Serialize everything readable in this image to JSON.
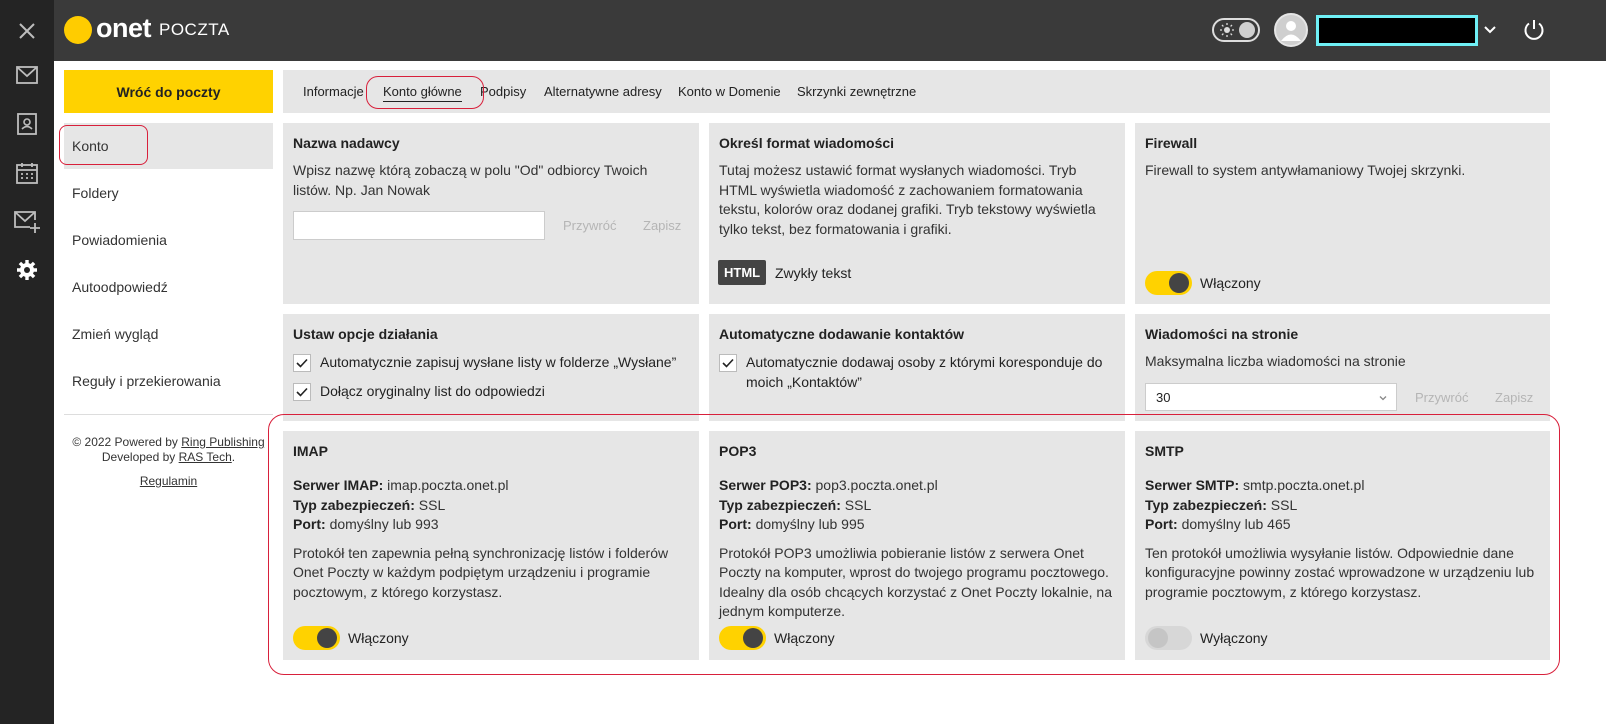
{
  "header": {
    "logo_text": "onet",
    "logo_product": "POCZTA"
  },
  "nav": {
    "back_label": "Wróć do poczty",
    "items": [
      {
        "label": "Konto",
        "active": true
      },
      {
        "label": "Foldery",
        "active": false
      },
      {
        "label": "Powiadomienia",
        "active": false
      },
      {
        "label": "Autoodpowiedź",
        "active": false
      },
      {
        "label": "Zmień wygląd",
        "active": false
      },
      {
        "label": "Reguły i przekierowania",
        "active": false
      }
    ],
    "footer": {
      "copyright": "© 2022 Powered by",
      "ring": "Ring Publishing",
      "developed": "Developed by",
      "ras": "RAS Tech",
      "dot": ".",
      "regulamin": "Regulamin"
    }
  },
  "tabs": [
    {
      "label": "Informacje"
    },
    {
      "label": "Konto główne",
      "active": true
    },
    {
      "label": "Podpisy"
    },
    {
      "label": "Alternatywne adresy"
    },
    {
      "label": "Konto w Domenie"
    },
    {
      "label": "Skrzynki zewnętrzne"
    }
  ],
  "cards": {
    "sender": {
      "title": "Nazwa nadawcy",
      "text": "Wpisz nazwę którą zobaczą w polu \"Od\" odbiorcy Twoich listów. Np. Jan Nowak",
      "input_value": "",
      "reset": "Przywróć",
      "save": "Zapisz"
    },
    "format": {
      "title": "Określ format wiadomości",
      "text": "Tutaj możesz ustawić format wysłanych wiadomości. Tryb HTML wyświetla wiadomość z zachowaniem formatowania tekstu, kolorów oraz dodanej grafiki. Tryb tekstowy wyświetla tylko tekst, bez formatowania i grafiki.",
      "html": "HTML",
      "plain": "Zwykły tekst"
    },
    "firewall": {
      "title": "Firewall",
      "text": "Firewall to system antywłamaniowy Twojej skrzynki.",
      "status": "Włączony"
    },
    "options": {
      "title": "Ustaw opcje działania",
      "opt1": "Automatycznie zapisuj wysłane listy w folderze „Wysłane”",
      "opt2": "Dołącz oryginalny list do odpowiedzi"
    },
    "contacts": {
      "title": "Automatyczne dodawanie kontaktów",
      "opt1": "Automatycznie dodawaj osoby z którymi koresponduje do moich „Kontaktów”"
    },
    "per_page": {
      "title": "Wiadomości na stronie",
      "text": "Maksymalna liczba wiadomości na stronie",
      "value": "30",
      "reset": "Przywróć",
      "save": "Zapisz"
    },
    "imap": {
      "title": "IMAP",
      "server_label": "Serwer IMAP:",
      "server": "imap.poczta.onet.pl",
      "sec_label": "Typ zabezpieczeń:",
      "sec": "SSL",
      "port_label": "Port:",
      "port": "domyślny lub 993",
      "desc": "Protokół ten zapewnia pełną synchronizację listów i folderów Onet Poczty w każdym podpiętym urządzeniu i programie pocztowym, z którego korzystasz.",
      "status": "Włączony"
    },
    "pop3": {
      "title": "POP3",
      "server_label": "Serwer POP3:",
      "server": "pop3.poczta.onet.pl",
      "sec_label": "Typ zabezpieczeń:",
      "sec": "SSL",
      "port_label": "Port:",
      "port": "domyślny lub 995",
      "desc": "Protokół POP3 umożliwia pobieranie listów z serwera Onet Poczty na komputer, wprost do twojego programu pocztowego. Idealny dla osób chcących korzystać z Onet Poczty lokalnie, na jednym komputerze.",
      "status": "Włączony"
    },
    "smtp": {
      "title": "SMTP",
      "server_label": "Serwer SMTP:",
      "server": "smtp.poczta.onet.pl",
      "sec_label": "Typ zabezpieczeń:",
      "sec": "SSL",
      "port_label": "Port:",
      "port": "domyślny lub 465",
      "desc": "Ten protokół umożliwia wysyłanie listów. Odpowiednie dane konfiguracyjne powinny zostać wprowadzone w urządzeniu lub programie pocztowym, z którego korzystasz.",
      "status": "Wyłączony"
    }
  },
  "colors": {
    "accent": "#ffd200",
    "rail": "#242424",
    "header": "#3a3a3a",
    "card": "#e6e6e6",
    "annotation": "#d8203b"
  }
}
